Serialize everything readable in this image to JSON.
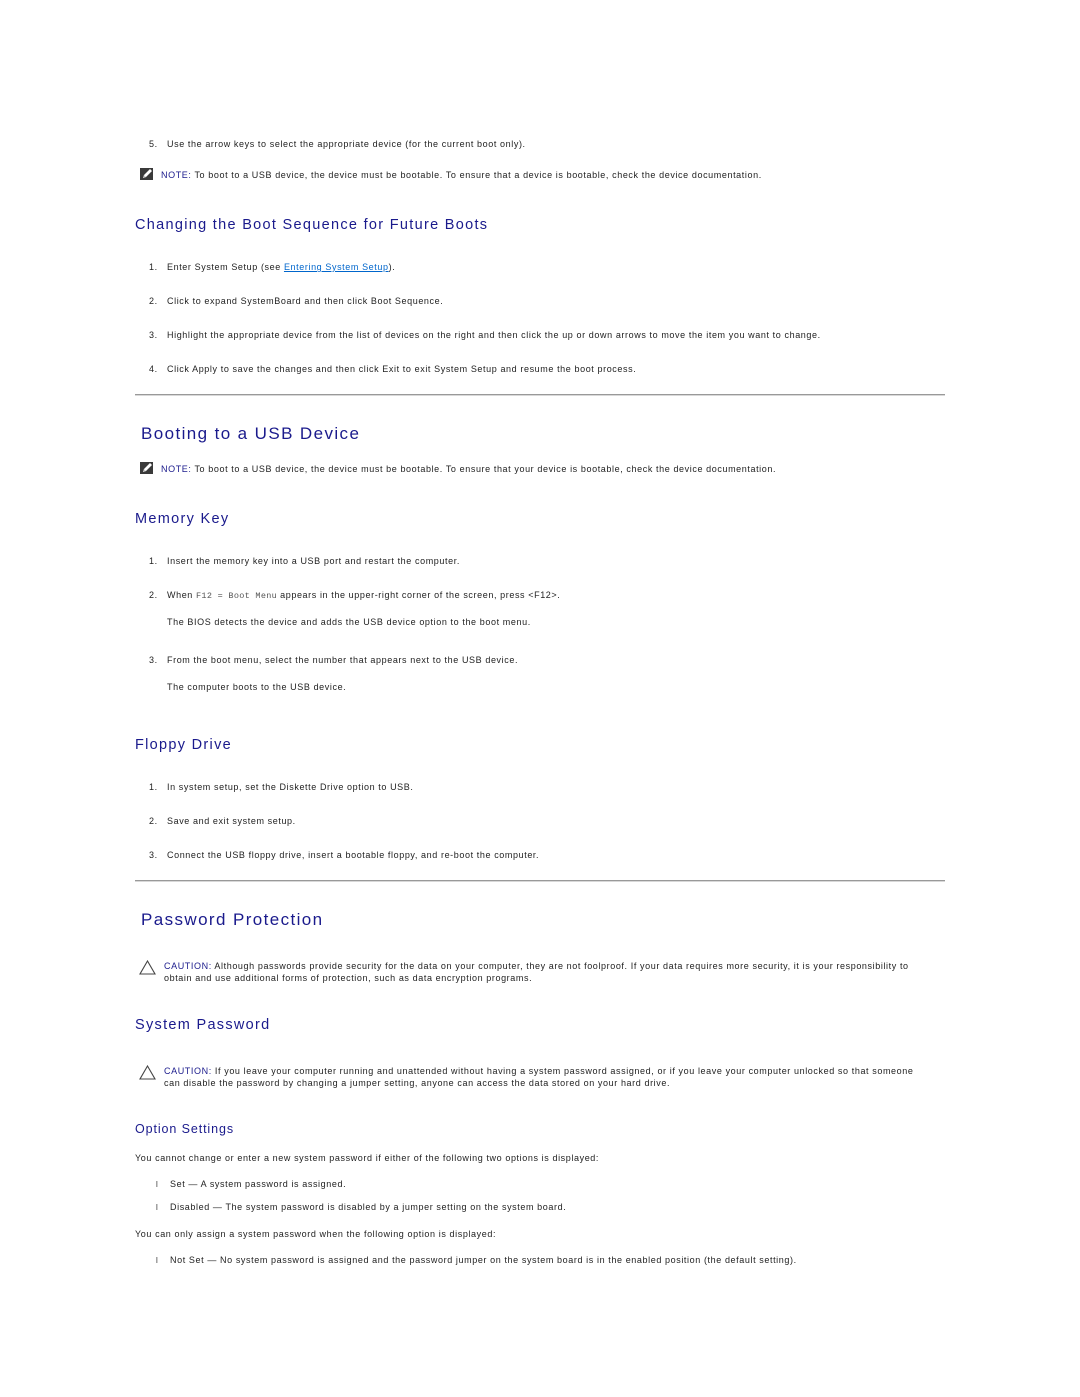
{
  "intro": {
    "step5": {
      "number": "5.",
      "text": "Use the arrow keys to select the appropriate device (for the current boot only)."
    },
    "note": {
      "icon": "pencil-note-icon",
      "label": "NOTE:",
      "text": " To boot to a USB device, the device must be bootable. To ensure that a device is bootable, check the device documentation."
    }
  },
  "changing_boot_sequence": {
    "heading": "Changing the Boot Sequence for Future Boots",
    "steps": [
      {
        "number": "1.",
        "text_before": "Enter System Setup (see ",
        "link": "Entering System Setup",
        "text_after": ")."
      },
      {
        "number": "2.",
        "text": "Click to expand SystemBoard and then click Boot Sequence."
      },
      {
        "number": "3.",
        "text": "Highlight the appropriate device from the list of devices on the right and then click the up or down arrows to move the item you want to change."
      },
      {
        "number": "4.",
        "text": "Click Apply to save the changes and then click Exit to exit System Setup and resume the boot process."
      }
    ]
  },
  "booting_usb": {
    "heading": "Booting to a USB Device",
    "note": {
      "icon": "pencil-note-icon",
      "label": "NOTE:",
      "text": " To boot to a USB device, the device must be bootable. To ensure that your device is bootable, check the device documentation."
    },
    "memory_key": {
      "heading": "Memory Key",
      "steps": [
        {
          "number": "1.",
          "text": "Insert the memory key into a USB port and restart the computer."
        },
        {
          "number": "2.",
          "text_before": "When ",
          "code": "F12 = Boot Menu",
          "text_after": " appears in the upper-right corner of the screen, press <F12>.",
          "subtext": "The BIOS detects the device and adds the USB device option to the boot menu."
        },
        {
          "number": "3.",
          "text": "From the boot menu, select the number that appears next to the USB device.",
          "subtext": "The computer boots to the USB device."
        }
      ]
    },
    "floppy_drive": {
      "heading": "Floppy Drive",
      "steps": [
        {
          "number": "1.",
          "text": "In system setup, set the Diskette Drive option to USB."
        },
        {
          "number": "2.",
          "text": "Save and exit system setup."
        },
        {
          "number": "3.",
          "text": "Connect the USB floppy drive, insert a bootable floppy, and re-boot the computer."
        }
      ]
    }
  },
  "password_protection": {
    "heading": "Password Protection",
    "caution": {
      "icon": "caution-triangle-icon",
      "label": "CAUTION:",
      "text": " Although passwords provide security for the data on your computer, they are not foolproof. If your data requires more security, it is your responsibility to obtain and use additional forms of protection, such as data encryption programs."
    },
    "system_password": {
      "heading": "System Password",
      "caution": {
        "icon": "caution-triangle-icon",
        "label": "CAUTION:",
        "text": " If you leave your computer running and unattended without having a system password assigned, or if you leave your computer unlocked so that someone can disable the password by changing a jumper setting, anyone can access the data stored on your hard drive."
      },
      "option_settings": {
        "heading": "Option Settings",
        "intro": "You cannot change or enter a new system password if either of the following two options is displayed:",
        "bullet_glyph": "l",
        "options_blocked": [
          "Set — A system password is assigned.",
          "Disabled — The system password is disabled by a jumper setting on the system board."
        ],
        "intro2": "You can only assign a system password when the following option is displayed:",
        "options_allowed": [
          "Not Set — No system password is assigned and the password jumper on the system board is in the enabled position (the default setting)."
        ]
      }
    }
  }
}
